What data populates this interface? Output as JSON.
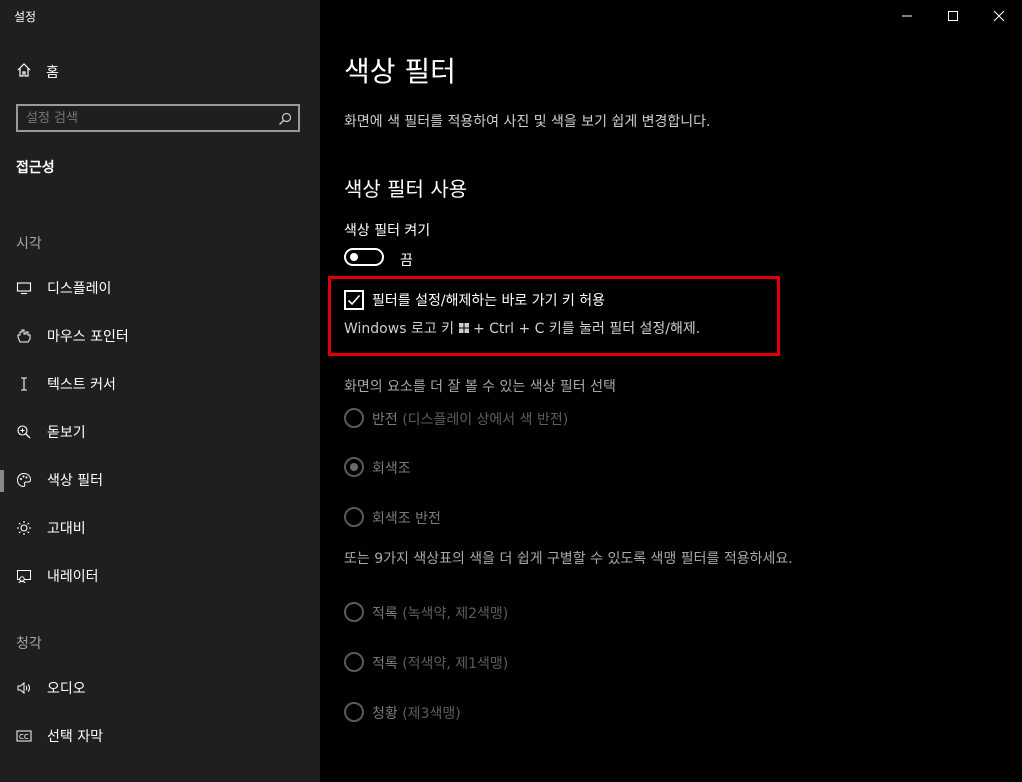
{
  "window": {
    "title": "설정"
  },
  "sidebar": {
    "home_label": "홈",
    "search_placeholder": "설정 검색",
    "current_group": "접근성",
    "vision_section": "시각",
    "vision_items": [
      {
        "label": "디스플레이",
        "icon": "display-icon"
      },
      {
        "label": "마우스 포인터",
        "icon": "mouse-pointer-icon"
      },
      {
        "label": "텍스트 커서",
        "icon": "text-cursor-icon"
      },
      {
        "label": "돋보기",
        "icon": "magnifier-icon"
      },
      {
        "label": "색상 필터",
        "icon": "color-filter-icon",
        "selected": true
      },
      {
        "label": "고대비",
        "icon": "high-contrast-icon"
      },
      {
        "label": "내레이터",
        "icon": "narrator-icon"
      }
    ],
    "hearing_section": "청각",
    "hearing_items": [
      {
        "label": "오디오",
        "icon": "audio-icon"
      },
      {
        "label": "선택 자막",
        "icon": "closed-captions-icon"
      }
    ]
  },
  "main": {
    "title": "색상 필터",
    "subtitle": "화면에 색 필터를 적용하여 사진 및 색을 보기 쉽게 변경합니다.",
    "section_title": "색상 필터 사용",
    "toggle_label": "색상 필터 켜기",
    "toggle_state": "끔",
    "toggle_on": false,
    "shortcut_checkbox": {
      "label": "필터를 설정/해제하는 바로 가기 키 허용",
      "checked": true,
      "desc_before": "Windows 로고 키 ",
      "desc_icon": "windows-logo-icon",
      "desc_after": " + Ctrl + C 키를 눌러 필터 설정/해제."
    },
    "filter_select_heading": "화면의 요소를 더 잘 볼 수 있는 색상 필터 선택",
    "filter_options": [
      {
        "label": "반전",
        "note": " (디스플레이 상에서 색 반전)",
        "checked": false
      },
      {
        "label": "회색조",
        "note": "",
        "checked": true
      },
      {
        "label": "회색조 반전",
        "note": "",
        "checked": false
      }
    ],
    "colorblind_heading": "또는 9가지 색상표의 색을 더 쉽게 구별할 수 있도록 색맹 필터를 적용하세요.",
    "colorblind_options": [
      {
        "label": "적록",
        "note": " (녹색약, 제2색맹)",
        "checked": false
      },
      {
        "label": "적록",
        "note": " (적색약, 제1색맹)",
        "checked": false
      },
      {
        "label": "청황",
        "note": " (제3색맹)",
        "checked": false
      }
    ]
  },
  "colors": {
    "highlight_border": "#e00000",
    "sidebar_bg": "#1f1f1f",
    "main_bg": "#000000"
  }
}
